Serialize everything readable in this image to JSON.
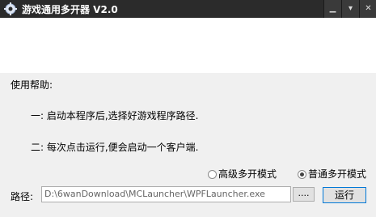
{
  "window": {
    "title": "游戏通用多开器 V2.0",
    "icon": "gear-app-icon",
    "buttons": {
      "minimize": "▁",
      "menu": "▾",
      "close": "✕"
    }
  },
  "help": {
    "heading": "使用帮助:",
    "step1": "一: 启动本程序后,选择好游戏程序路径.",
    "step2": "二: 每次点击运行,便会启动一个客户端."
  },
  "mode": {
    "advanced_label": "高级多开模式",
    "normal_label": "普通多开模式",
    "selected": "normal"
  },
  "path": {
    "label": "路径:",
    "value": "D:\\6wanDownload\\MCLauncher\\WPFLauncher.exe",
    "browse_label": "....",
    "run_label": "运行"
  },
  "colors": {
    "titlebar": "#2b2b2b",
    "body": "#f0f0f0",
    "accent": "#0078d7"
  }
}
